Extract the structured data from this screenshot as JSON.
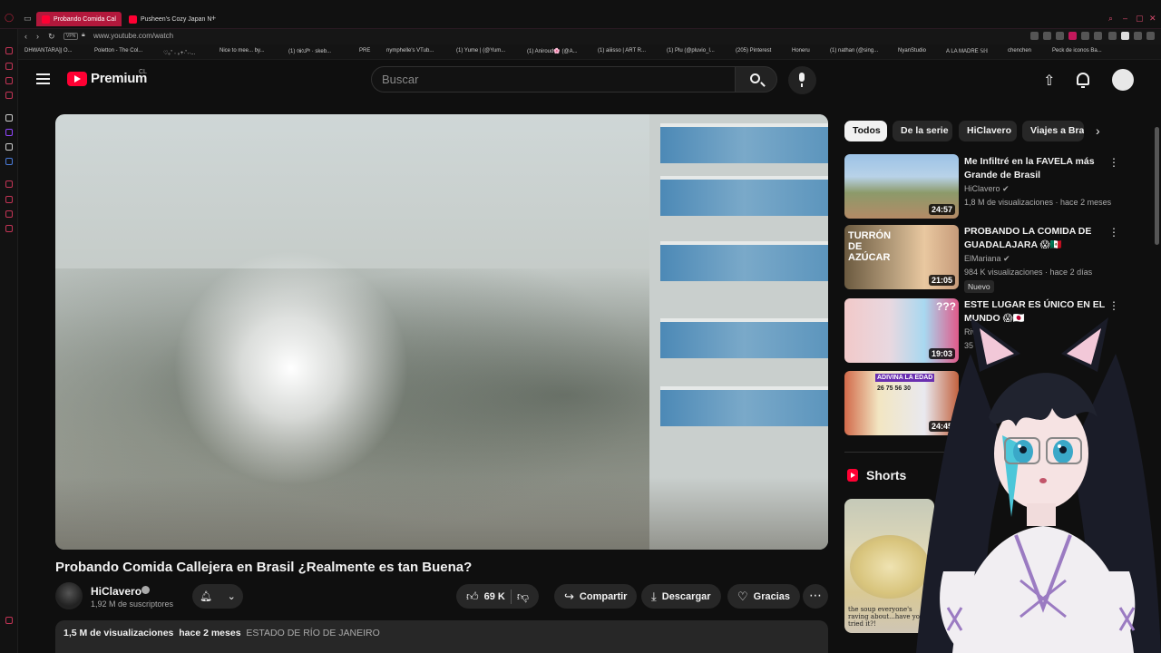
{
  "browser": {
    "tabs": [
      {
        "label": "Probando Comida Cal",
        "active": true
      },
      {
        "label": "Pusheen's Cozy Japan N",
        "active": false
      }
    ],
    "new_tab": "+",
    "url": "www.youtube.com/watch",
    "vpn_label": "VPN",
    "bookmarks": [
      "DHWANTARA]| O...",
      "Poletton - The Col...",
      "♡｡˚ ˖ ｡+·˚˖·...",
      "Nice to mee... by...",
      "(1) ◊ℹ◊𝒮ᵉ · skeb...",
      "PRE",
      "nymphelle's VTub...",
      "(1) Yume | (@Yum...",
      "(1) Aniroud🌸 (@A...",
      "(1) aiiisso | ART R...",
      "(1) Plu (@pluvio_l...",
      "(205) Pinterest",
      "Honeru",
      "(1) nathan (@sing...",
      "NyanStudio",
      "A LA MADRE 𝕊ℍ",
      "chenchen",
      "Peck de iconos Ba..."
    ],
    "accent": "#b3183c"
  },
  "header": {
    "logo": "Premium",
    "country": "CL",
    "search_placeholder": "Buscar"
  },
  "video": {
    "title": "Probando Comida Callejera en Brasil ¿Realmente es tan Buena?",
    "channel": "HiClavero",
    "subscribers": "1,92 M de suscriptores",
    "likes": "69 K",
    "share": "Compartir",
    "download": "Descargar",
    "thanks": "Gracias",
    "views": "1,5 M de visualizaciones",
    "date": "hace 2 meses",
    "location": "ESTADO DE RÍO DE JANEIRO"
  },
  "chips": [
    "Todos",
    "De la serie",
    "HiClavero",
    "Viajes a Bra"
  ],
  "recommendations": [
    {
      "title": "Me Infiltré en la FAVELA más Grande de Brasil",
      "channel": "HiClavero",
      "meta": "1,8 M de visualizaciones · hace 2 meses",
      "duration": "24:57"
    },
    {
      "title": "PROBANDO LA COMIDA DE GUADALAJARA 😱🇲🇽",
      "channel": "ElMariana",
      "meta": "984 K visualizaciones · hace 2 días",
      "duration": "21:05",
      "badge": "Nuevo",
      "thumb_text": "TURRÓN DE AZÚCAR"
    },
    {
      "title": "ESTE LUGAR ES ÚNICO EN EL MUNDO 😱🇯🇵",
      "channel": "Rivers",
      "meta": "35 M",
      "duration": "19:03",
      "thumb_text": "???"
    },
    {
      "title": "",
      "channel": "",
      "meta": "",
      "duration": "24:45",
      "thumb_text": "ADIVINA LA EDAD",
      "thumb_numbers": "26 75 56 30"
    }
  ],
  "shorts": {
    "label": "Shorts",
    "caption": "the soup everyone's raving about...have you tried it?!"
  }
}
